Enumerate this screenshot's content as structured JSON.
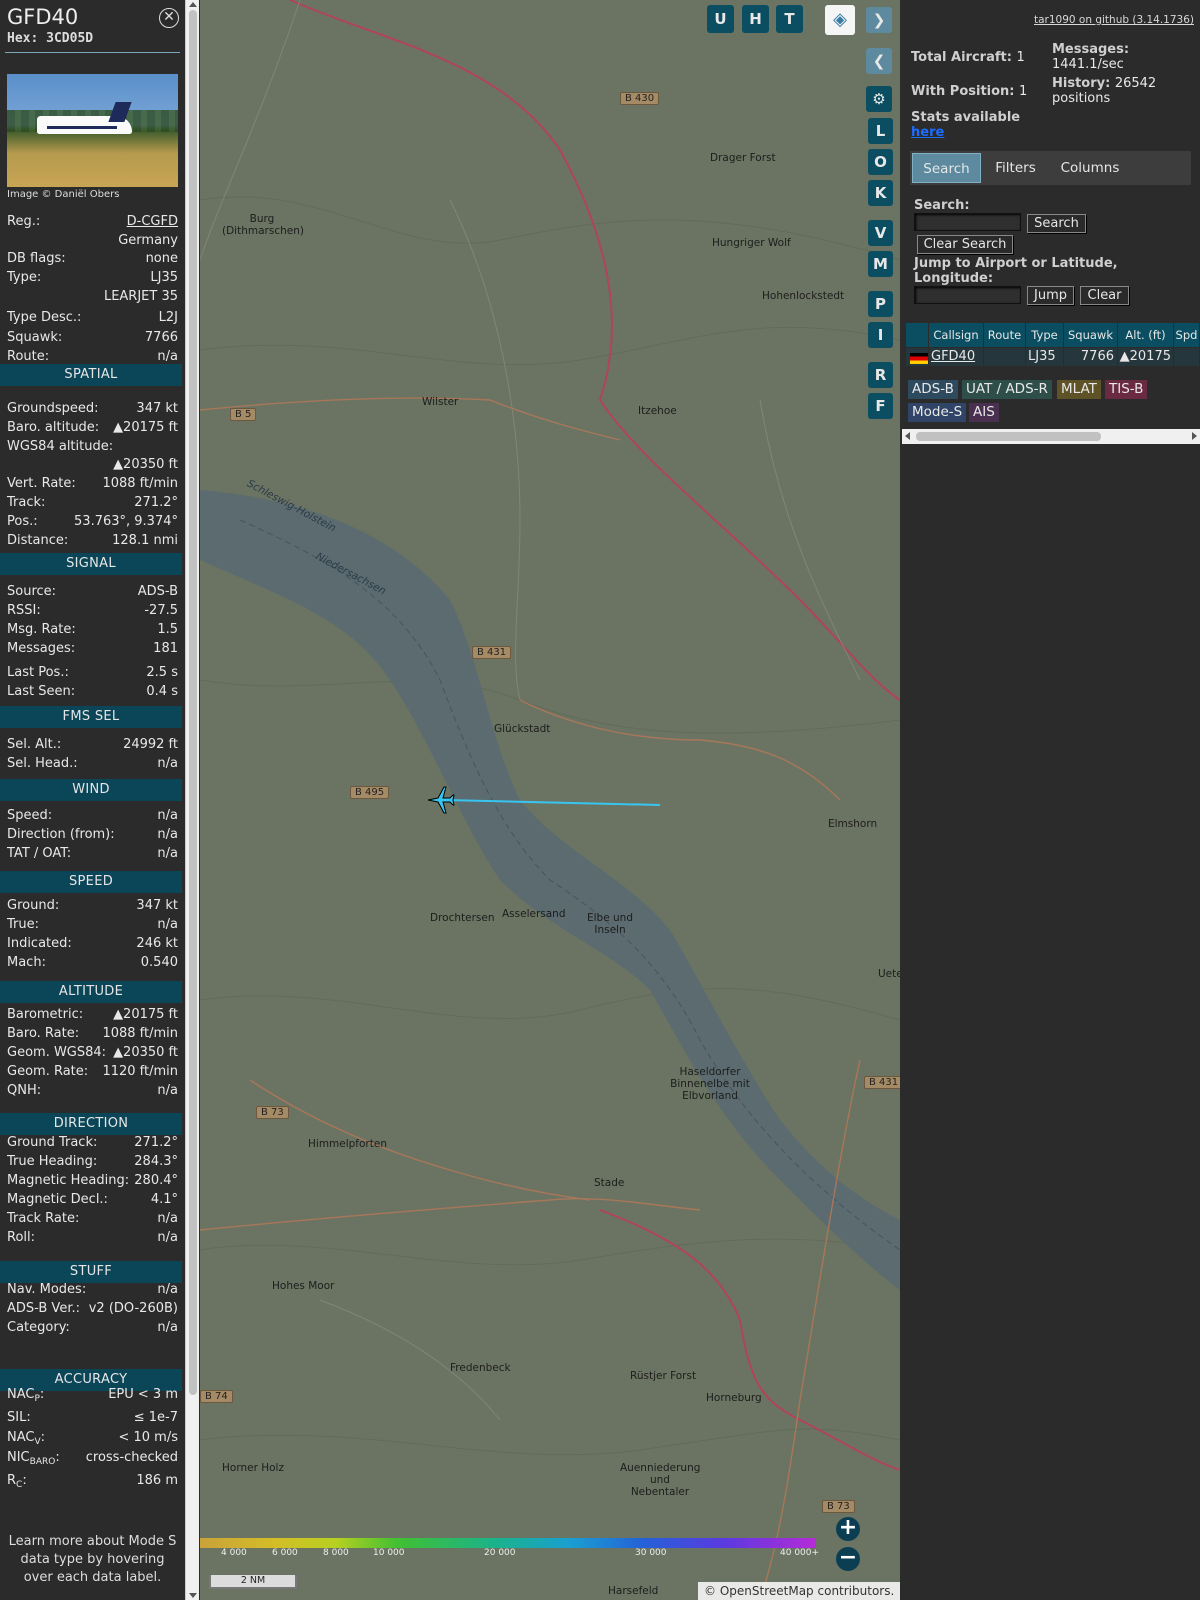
{
  "aircraft": {
    "callsign": "GFD40",
    "hex": "Hex: 3CD05D",
    "image_credit": "Image © Daniël Obers"
  },
  "info_rows": [
    {
      "k": "Reg.:",
      "v": "D-CGFD"
    },
    {
      "k": "",
      "v": "Germany"
    },
    {
      "k": "DB flags:",
      "v": "none"
    },
    {
      "k": "Type:",
      "v": "LJ35"
    },
    {
      "k": "",
      "v": "LEARJET 35"
    },
    {
      "k": "Type Desc.:",
      "v": "L2J"
    },
    {
      "k": "Squawk:",
      "v": "7766"
    },
    {
      "k": "Route:",
      "v": "n/a"
    }
  ],
  "sections": {
    "spatial": {
      "title": "SPATIAL",
      "rows": [
        {
          "k": "Groundspeed:",
          "v": "347 kt"
        },
        {
          "k": "Baro. altitude:",
          "v": "▲20175 ft"
        },
        {
          "k": "WGS84 altitude:",
          "v": ""
        },
        {
          "k": "",
          "v": "▲20350 ft"
        },
        {
          "k": "Vert. Rate:",
          "v": "1088 ft/min"
        },
        {
          "k": "Track:",
          "v": "271.2°"
        },
        {
          "k": "Pos.:",
          "v": "53.763°, 9.374°"
        },
        {
          "k": "Distance:",
          "v": "128.1 nmi"
        }
      ]
    },
    "signal": {
      "title": "SIGNAL",
      "rows": [
        {
          "k": "Source:",
          "v": "ADS-B"
        },
        {
          "k": "RSSI:",
          "v": "-27.5"
        },
        {
          "k": "Msg. Rate:",
          "v": "1.5"
        },
        {
          "k": "Messages:",
          "v": "181"
        },
        {
          "k": "Last Pos.:",
          "v": "2.5 s"
        },
        {
          "k": "Last Seen:",
          "v": "0.4 s"
        }
      ]
    },
    "fms": {
      "title": "FMS SEL",
      "rows": [
        {
          "k": "Sel. Alt.:",
          "v": "24992 ft"
        },
        {
          "k": "Sel. Head.:",
          "v": "n/a"
        }
      ]
    },
    "wind": {
      "title": "WIND",
      "rows": [
        {
          "k": "Speed:",
          "v": "n/a"
        },
        {
          "k": "Direction (from):",
          "v": "n/a"
        },
        {
          "k": "TAT / OAT:",
          "v": "n/a"
        }
      ]
    },
    "speed": {
      "title": "SPEED",
      "rows": [
        {
          "k": "Ground:",
          "v": "347 kt"
        },
        {
          "k": "True:",
          "v": "n/a"
        },
        {
          "k": "Indicated:",
          "v": "246 kt"
        },
        {
          "k": "Mach:",
          "v": "0.540"
        }
      ]
    },
    "altitude": {
      "title": "ALTITUDE",
      "rows": [
        {
          "k": "Barometric:",
          "v": "▲20175 ft"
        },
        {
          "k": "Baro. Rate:",
          "v": "1088 ft/min"
        },
        {
          "k": "Geom. WGS84:",
          "v": "▲20350 ft"
        },
        {
          "k": "Geom. Rate:",
          "v": "1120 ft/min"
        },
        {
          "k": "QNH:",
          "v": "n/a"
        }
      ]
    },
    "direction": {
      "title": "DIRECTION",
      "rows": [
        {
          "k": "Ground Track:",
          "v": "271.2°"
        },
        {
          "k": "True Heading:",
          "v": "284.3°"
        },
        {
          "k": "Magnetic Heading:",
          "v": "280.4°"
        },
        {
          "k": "Magnetic Decl.:",
          "v": "4.1°"
        },
        {
          "k": "Track Rate:",
          "v": "n/a"
        },
        {
          "k": "Roll:",
          "v": "n/a"
        }
      ]
    },
    "stuff": {
      "title": "STUFF",
      "rows": [
        {
          "k": "Nav. Modes:",
          "v": "n/a"
        },
        {
          "k": "ADS-B Ver.:",
          "v": "v2 (DO-260B)"
        },
        {
          "k": "Category:",
          "v": "n/a"
        }
      ]
    },
    "accuracy": {
      "title": "ACCURACY",
      "rows": [
        {
          "k": "NAC",
          "sub": "P",
          "v": "EPU < 3 m"
        },
        {
          "k": "SIL:",
          "sub": "",
          "v": "≤ 1e-7"
        },
        {
          "k": "NAC",
          "sub": "V",
          "v": "< 10 m/s"
        },
        {
          "k": "NIC",
          "sub": "BARO",
          "v": "cross-checked"
        },
        {
          "k": "R",
          "sub": "C",
          "v": "186 m"
        }
      ]
    }
  },
  "footer_note": "Learn more about Mode S data type by hovering over each data label.",
  "map": {
    "buttons_top": [
      "U",
      "H",
      "T"
    ],
    "buttons_side": [
      "L",
      "O",
      "K",
      "V",
      "M",
      "P",
      "I",
      "R",
      "F"
    ],
    "labels": [
      {
        "text": "Burg (Dithmarschen)",
        "kind": "town"
      },
      {
        "text": "Hohenlockstedt",
        "kind": "town"
      },
      {
        "text": "Drager Forst",
        "kind": "town"
      },
      {
        "text": "Hungriger Wolf",
        "kind": "town"
      },
      {
        "text": "Wilster",
        "kind": "town"
      },
      {
        "text": "Itzehoe",
        "kind": "town"
      },
      {
        "text": "Glückstadt",
        "kind": "town"
      },
      {
        "text": "Elmshorn",
        "kind": "town"
      },
      {
        "text": "Drochtersen",
        "kind": "town"
      },
      {
        "text": "Asselersand",
        "kind": "town"
      },
      {
        "text": "Elbe und Inseln",
        "kind": "town"
      },
      {
        "text": "Uetersen",
        "kind": "town"
      },
      {
        "text": "Haseldorfer Binnenelbe mit Elbvorland",
        "kind": "town"
      },
      {
        "text": "Himmelpforten",
        "kind": "town"
      },
      {
        "text": "Stade",
        "kind": "town"
      },
      {
        "text": "Hohes Moor",
        "kind": "town"
      },
      {
        "text": "Fredenbeck",
        "kind": "town"
      },
      {
        "text": "Rüstjer Forst",
        "kind": "town"
      },
      {
        "text": "Horneburg",
        "kind": "town"
      },
      {
        "text": "Auenniederung und Nebentaler",
        "kind": "town"
      },
      {
        "text": "Horner Holz",
        "kind": "town"
      },
      {
        "text": "Harsefeld",
        "kind": "town"
      },
      {
        "text": "Schleswig-Holstein",
        "kind": "water"
      },
      {
        "text": "Niedersachsen",
        "kind": "water"
      },
      {
        "text": "B 430",
        "kind": "road"
      },
      {
        "text": "B 5",
        "kind": "road"
      },
      {
        "text": "B 431",
        "kind": "road"
      },
      {
        "text": "B 495",
        "kind": "road"
      },
      {
        "text": "B 431",
        "kind": "road"
      },
      {
        "text": "B 73",
        "kind": "road"
      },
      {
        "text": "B 74",
        "kind": "road"
      },
      {
        "text": "B 73",
        "kind": "road"
      }
    ],
    "legend_ticks": [
      "4 000",
      "6 000",
      "8 000",
      "10 000",
      "20 000",
      "30 000",
      "40 000+"
    ],
    "scale": "2 NM",
    "attribution_link": "OpenStreetMap",
    "attribution_text": "contributors."
  },
  "panel": {
    "github": "tar1090 on github (3.14.1736)",
    "total_aircraft_label": "Total Aircraft:",
    "total_aircraft": "1",
    "with_position_label": "With Position:",
    "with_position": "1",
    "stats_label": "Stats available",
    "stats_link": "here",
    "messages_label": "Messages:",
    "messages": "1441.1/sec",
    "history_label": "History:",
    "history": "26542 positions",
    "tabs": [
      "Search",
      "Filters",
      "Columns"
    ],
    "search_label": "Search:",
    "search_value": "",
    "search_button": "Search",
    "clear_search_button": "Clear Search",
    "jump_label": "Jump to Airport or Latitude, Longitude:",
    "jump_value": "",
    "jump_button": "Jump",
    "clear_button": "Clear",
    "table_headers": [
      "Callsign",
      "Route",
      "Type",
      "Squawk",
      "Alt. (ft)",
      "Spd"
    ],
    "table_row": {
      "callsign": "GFD40",
      "route": "",
      "type": "LJ35",
      "squawk": "7766",
      "alt": "▲20175",
      "spd": ""
    },
    "sources": [
      {
        "label": "ADS-B",
        "color": "#2e4a5e"
      },
      {
        "label": "UAT / ADS-R",
        "color": "#2e4e4a"
      },
      {
        "label": "MLAT",
        "color": "#5e5226"
      },
      {
        "label": "TIS-B",
        "color": "#6a2a42"
      },
      {
        "label": "Mode-S",
        "color": "#2f4466"
      },
      {
        "label": "AIS",
        "color": "#4a3050"
      }
    ]
  }
}
